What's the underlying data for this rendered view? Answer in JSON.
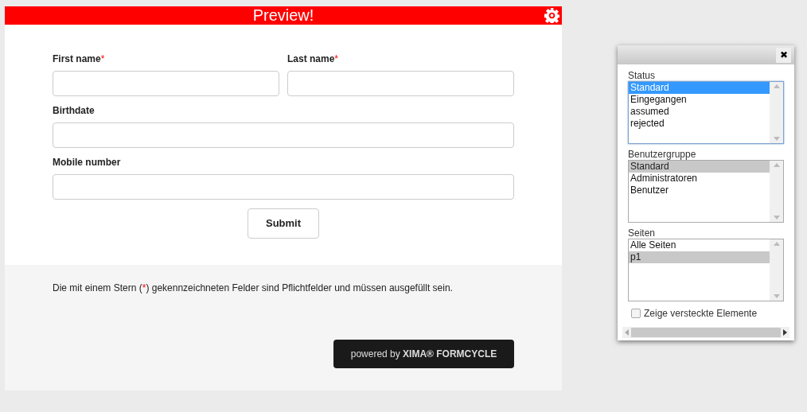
{
  "preview_bar": {
    "title": "Preview!"
  },
  "form": {
    "required_mark": "*",
    "rows": [
      {
        "fields": [
          {
            "label": "First name",
            "required": true
          },
          {
            "label": "Last name",
            "required": true
          }
        ]
      },
      {
        "fields": [
          {
            "label": "Birthdate",
            "required": false
          }
        ]
      },
      {
        "fields": [
          {
            "label": "Mobile number",
            "required": false
          }
        ]
      }
    ],
    "submit": "Submit"
  },
  "footer": {
    "note": {
      "before": "Die mit einem Stern (",
      "mark": "*",
      "after": ") gekennzeichneten Felder sind Pflichtfelder und müssen ausgefüllt sein."
    },
    "powered_by": "powered by **XIMA® FORMCYCLE**"
  },
  "dialog": {
    "close": "✖",
    "lists": [
      {
        "label": "Status",
        "focused": true,
        "items": [
          {
            "text": "Standard",
            "selected": true
          },
          {
            "text": "Eingegangen",
            "selected": false
          },
          {
            "text": "assumed",
            "selected": false
          },
          {
            "text": "rejected",
            "selected": false
          }
        ]
      },
      {
        "label": "Benutzergruppe",
        "focused": false,
        "items": [
          {
            "text": "Standard",
            "selected": true
          },
          {
            "text": "Administratoren",
            "selected": false
          },
          {
            "text": "Benutzer",
            "selected": false
          }
        ]
      },
      {
        "label": "Seiten",
        "focused": false,
        "items": [
          {
            "text": "Alle Seiten",
            "selected": false
          },
          {
            "text": "p1",
            "selected": true
          }
        ]
      }
    ],
    "show_hidden": {
      "label": "Zeige versteckte Elemente",
      "checked": false
    }
  }
}
